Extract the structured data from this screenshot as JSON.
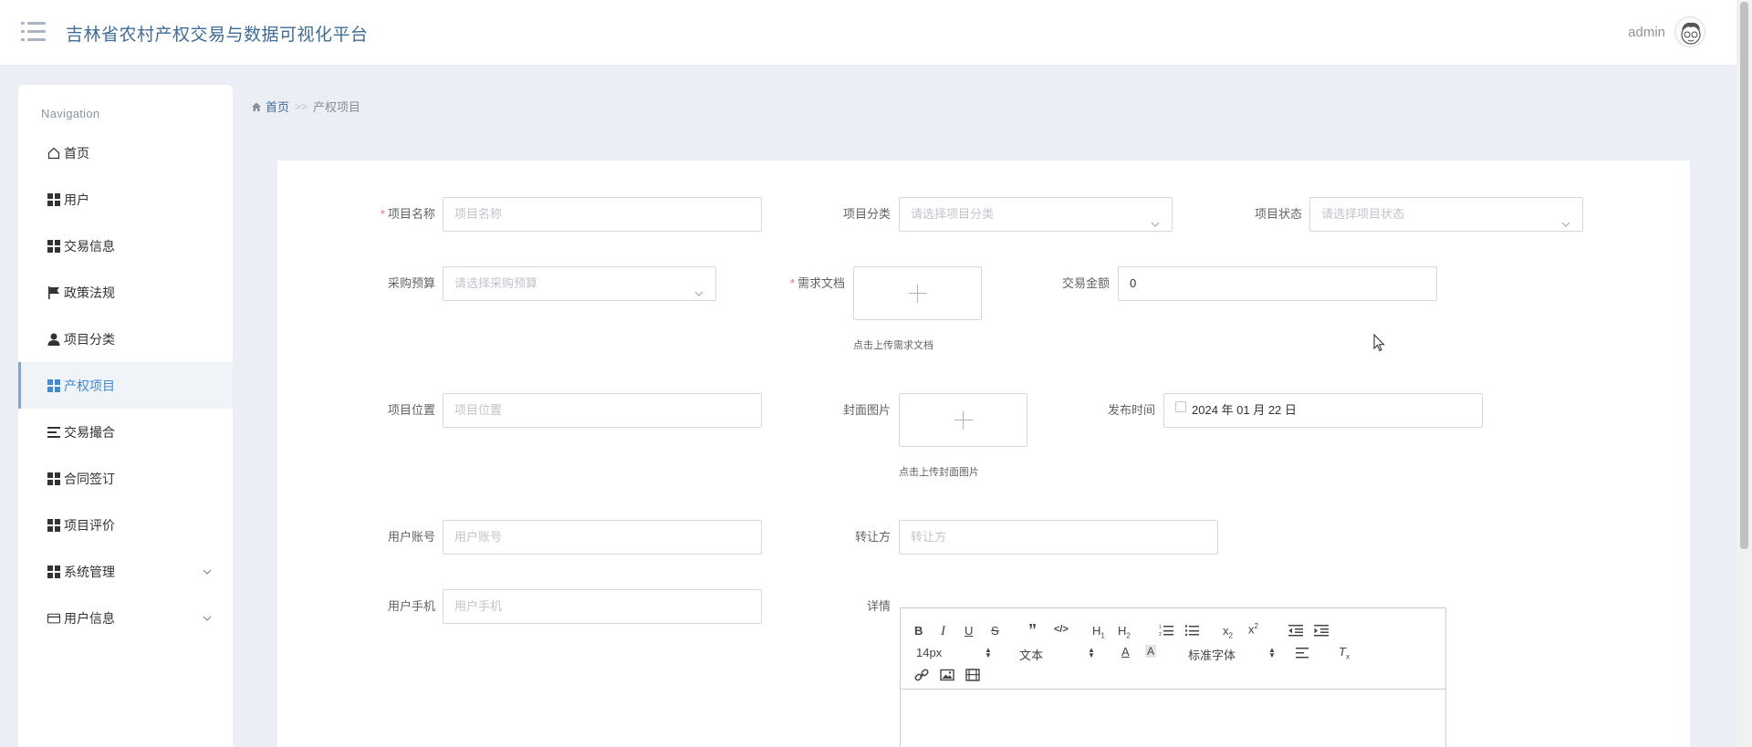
{
  "header": {
    "app_title": "吉林省农村产权交易与数据可视化平台",
    "user_name": "admin"
  },
  "sidebar": {
    "heading": "Navigation",
    "items": [
      {
        "label": "首页",
        "icon": "home-icon"
      },
      {
        "label": "用户",
        "icon": "grid-icon"
      },
      {
        "label": "交易信息",
        "icon": "grid-icon"
      },
      {
        "label": "政策法规",
        "icon": "flag-icon"
      },
      {
        "label": "项目分类",
        "icon": "user-icon"
      },
      {
        "label": "产权项目",
        "icon": "grid-icon",
        "active": true
      },
      {
        "label": "交易撮合",
        "icon": "list-icon"
      },
      {
        "label": "合同签订",
        "icon": "grid-icon"
      },
      {
        "label": "项目评价",
        "icon": "grid-icon"
      },
      {
        "label": "系统管理",
        "icon": "grid-icon",
        "expandable": true
      },
      {
        "label": "用户信息",
        "icon": "card-icon",
        "expandable": true
      }
    ]
  },
  "breadcrumb": {
    "home": "首页",
    "separator": ">>",
    "current": "产权项目"
  },
  "form": {
    "project_name": {
      "label": "项目名称",
      "required": true,
      "placeholder": "项目名称"
    },
    "project_category": {
      "label": "项目分类",
      "placeholder": "请选择项目分类"
    },
    "project_status": {
      "label": "项目状态",
      "placeholder": "请选择项目状态"
    },
    "purchase_budget": {
      "label": "采购预算",
      "placeholder": "请选择采购预算"
    },
    "requirement_doc": {
      "label": "需求文档",
      "required": true,
      "hint": "点击上传需求文档"
    },
    "trade_amount": {
      "label": "交易金额",
      "value": "0"
    },
    "project_location": {
      "label": "项目位置",
      "placeholder": "项目位置"
    },
    "cover_image": {
      "label": "封面图片",
      "hint": "点击上传封面图片"
    },
    "publish_time": {
      "label": "发布时间",
      "value": "2024 年 01 月 22 日"
    },
    "user_account": {
      "label": "用户账号",
      "placeholder": "用户账号"
    },
    "transferor": {
      "label": "转让方",
      "placeholder": "转让方"
    },
    "user_phone": {
      "label": "用户手机",
      "placeholder": "用户手机"
    },
    "details": {
      "label": "详情"
    }
  },
  "editor": {
    "font_size": "14px",
    "header_type": "文本",
    "font_family": "标准字体"
  }
}
